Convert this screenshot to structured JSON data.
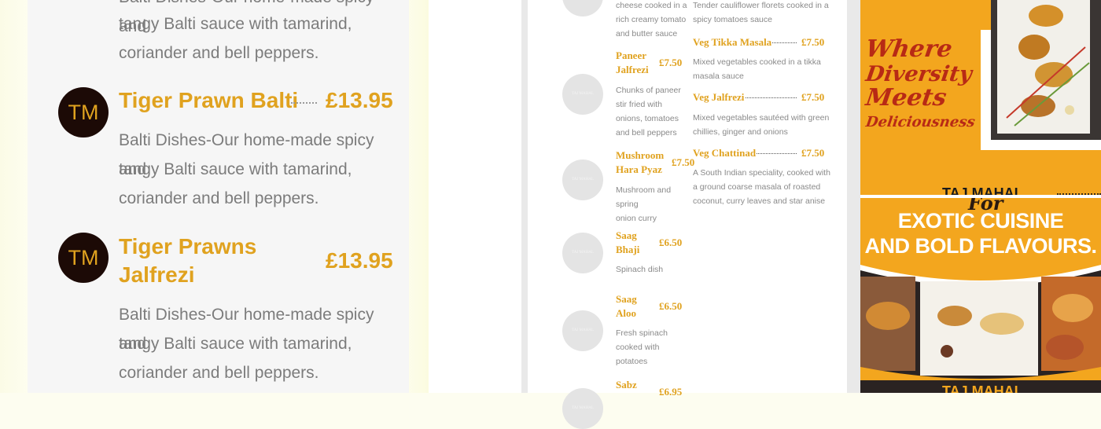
{
  "menu_left": {
    "top_text_partial": "Balti Dishes-Our home-made spicy and",
    "top_text_lines": [
      "tangy Balti sauce with tamarind,",
      "coriander and bell peppers."
    ],
    "items": [
      {
        "logo": "TM",
        "name": "Tiger Prawn Balti",
        "price": "£13.95",
        "desc_lines": [
          "Balti Dishes-Our home-made spicy and",
          "tangy Balti sauce with tamarind,",
          "coriander and bell peppers."
        ]
      },
      {
        "logo": "TM",
        "name_lines": [
          "Tiger Prawns",
          "Jalfrezi"
        ],
        "price": "£13.95",
        "desc_lines": [
          "Balti Dishes-Our home-made spicy and",
          "tangy Balti sauce with tamarind,",
          "coriander and bell peppers."
        ]
      }
    ]
  },
  "menu_middle": {
    "logo_text": "TAJ MAHAL",
    "col1": [
      {
        "desc_lines": [
          "cheese cooked in a",
          "rich creamy tomato",
          "and butter sauce"
        ]
      },
      {
        "name_lines": [
          "Paneer",
          "Jalfrezi"
        ],
        "price": "£7.50",
        "desc_lines": [
          "Chunks of paneer",
          "stir fried with",
          "onions, tomatoes",
          "and bell peppers"
        ]
      },
      {
        "name_lines": [
          "Mushroom",
          "Hara Pyaz"
        ],
        "price": "£7.50",
        "desc_lines": [
          "Mushroom and spring",
          "onion curry"
        ]
      },
      {
        "name_lines": [
          "Saag",
          "Bhaji"
        ],
        "price": "£6.50",
        "desc_lines": [
          "Spinach dish"
        ]
      },
      {
        "name_lines": [
          "Saag",
          "Aloo"
        ],
        "price": "£6.50",
        "desc_lines": [
          "Fresh spinach",
          "cooked with",
          "potatoes"
        ]
      },
      {
        "name_lines": [
          "Sabz"
        ],
        "price": "£6.95"
      }
    ],
    "col2": [
      {
        "desc_lines": [
          "Tender cauliflower florets cooked in a",
          "spicy tomatoes sauce"
        ]
      },
      {
        "name": "Veg Tikka Masala",
        "price": "£7.50",
        "desc_lines": [
          "Mixed vegetables cooked in a tikka",
          "masala sauce"
        ]
      },
      {
        "name": "Veg Jalfrezi",
        "price": "£7.50",
        "desc_lines": [
          "Mixed vegetables sautéed with green",
          "chillies, ginger and onions"
        ]
      },
      {
        "name": "Veg Chattinad",
        "price": "£7.50",
        "desc_lines": [
          "A South Indian speciality, cooked with",
          "a ground coarse masala of roasted",
          "coconut, curry leaves and star anise"
        ]
      }
    ]
  },
  "promo": {
    "tagline_lines": [
      "Where",
      "Diversity",
      "Meets",
      "Deliciousness"
    ],
    "brand": "TAJ MAHAL",
    "for_word": "For",
    "headline_lines": [
      "EXOTIC CUISINE",
      "AND BOLD FLAVOURS."
    ],
    "brand_bottom": "TAJ MAHAL"
  },
  "colors": {
    "accent": "#e0a21f",
    "promo_bg": "#f3a61e",
    "script_red": "#b82a15",
    "logo_dark": "#1c0a06"
  }
}
